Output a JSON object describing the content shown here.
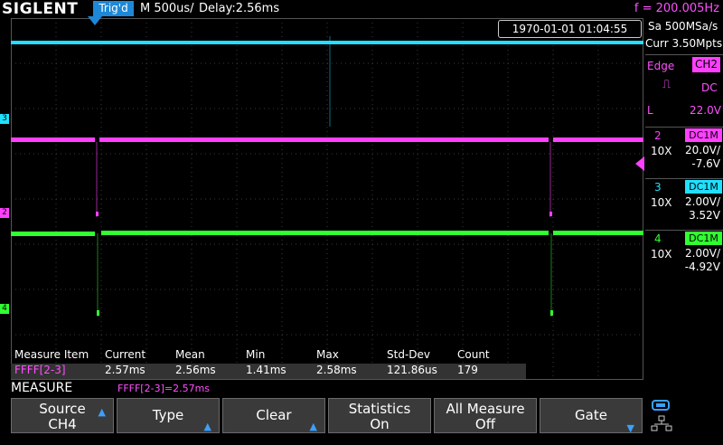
{
  "header": {
    "brand": "SIGLENT",
    "trig_status": "Trig'd",
    "timebase": "M 500us/",
    "delay": "Delay:2.56ms",
    "frequency": "f = 200.005Hz"
  },
  "timestamp": "1970-01-01 01:04:55",
  "acquisition": {
    "sample_rate": "Sa 500MSa/s",
    "memory": "Curr 3.50Mpts"
  },
  "trigger": {
    "type": "Edge",
    "source": "CH2",
    "coupling": "DC",
    "level_label": "L",
    "level": "22.0V"
  },
  "channels": [
    {
      "num": "2",
      "coupling": "DC1M",
      "probe": "10X",
      "volts_div": "20.0V/",
      "offset": "-7.6V",
      "color": "#ff40ff"
    },
    {
      "num": "3",
      "coupling": "DC1M",
      "probe": "10X",
      "volts_div": "2.00V/",
      "offset": "3.52V",
      "color": "#20e0ff"
    },
    {
      "num": "4",
      "coupling": "DC1M",
      "probe": "10X",
      "volts_div": "2.00V/",
      "offset": "-4.92V",
      "color": "#30ff30"
    }
  ],
  "channel_markers": {
    "ch3": "3",
    "ch2": "2",
    "ch4": "4"
  },
  "measure_table": {
    "headers": [
      "Measure Item",
      "Current",
      "Mean",
      "Min",
      "Max",
      "Std-Dev",
      "Count"
    ],
    "row": [
      "FFFF[2-3]",
      "2.57ms",
      "2.56ms",
      "1.41ms",
      "2.58ms",
      "121.86us",
      "179"
    ]
  },
  "measure_title": "MEASURE",
  "measure_readout": "FFFF[2-3]=2.57ms",
  "softkeys": [
    {
      "line1": "Source",
      "line2": "CH4",
      "arrow": "up"
    },
    {
      "line1": "Type",
      "line2": "",
      "arrow": "up"
    },
    {
      "line1": "Clear",
      "line2": "",
      "arrow": "up"
    },
    {
      "line1": "Statistics",
      "line2": "On",
      "arrow": ""
    },
    {
      "line1": "All Measure",
      "line2": "Off",
      "arrow": ""
    },
    {
      "line1": "Gate",
      "line2": "",
      "arrow": "down"
    }
  ],
  "colors": {
    "ch2": "#ff40ff",
    "ch3": "#20e0ff",
    "ch4": "#30ff30",
    "accent_blue": "#1e88d8"
  }
}
